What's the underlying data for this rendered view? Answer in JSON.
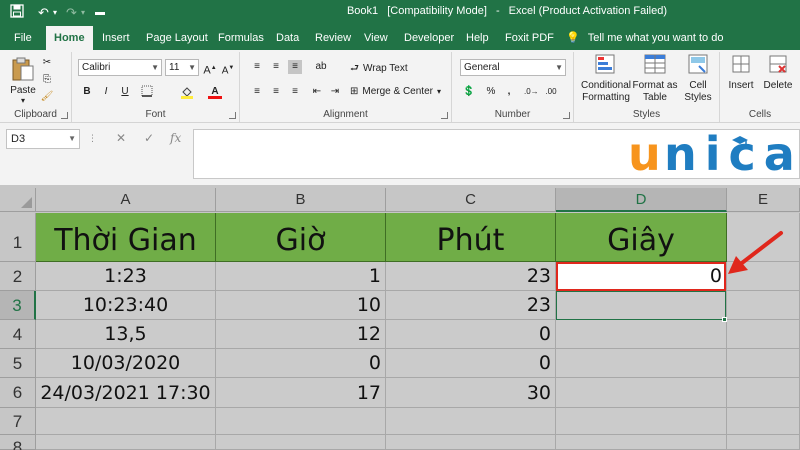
{
  "window": {
    "title_parts": [
      "Book1",
      "[Compatibility Mode]",
      "-",
      "Excel (Product Activation Failed)"
    ]
  },
  "tabs": [
    {
      "label": "File"
    },
    {
      "label": "Home"
    },
    {
      "label": "Insert"
    },
    {
      "label": "Page Layout"
    },
    {
      "label": "Formulas"
    },
    {
      "label": "Data"
    },
    {
      "label": "Review"
    },
    {
      "label": "View"
    },
    {
      "label": "Developer"
    },
    {
      "label": "Help"
    },
    {
      "label": "Foxit PDF"
    }
  ],
  "tell_me": "Tell me what you want to do",
  "ribbon": {
    "clipboard": {
      "paste": "Paste",
      "label": "Clipboard"
    },
    "font": {
      "name": "Calibri",
      "size": "11",
      "label": "Font",
      "bold": "B",
      "italic": "I",
      "underline": "U"
    },
    "alignment": {
      "wrap_text": "Wrap Text",
      "merge_center": "Merge & Center",
      "label": "Alignment"
    },
    "number": {
      "format": "General",
      "label": "Number",
      "percent": "%",
      "comma": ","
    },
    "styles": {
      "conditional_1": "Conditional",
      "conditional_2": "Formatting",
      "format_as_1": "Format as",
      "format_as_2": "Table",
      "cell_1": "Cell",
      "cell_2": "Styles",
      "label": "Styles"
    },
    "cells": {
      "insert": "Insert",
      "delete": "Delete",
      "label": "Cells"
    }
  },
  "formula_bar": {
    "name_box": "D3",
    "fx": "fx",
    "value": ""
  },
  "logo": {
    "text_u": "u",
    "text_rest": "nica"
  },
  "colors": {
    "excel_green": "#217346",
    "header_fill": "#70ad47",
    "highlight": "#e0271c",
    "logo_blue": "#1f7dc1",
    "logo_orange": "#f7941d"
  },
  "columns": [
    "A",
    "B",
    "C",
    "D",
    "E"
  ],
  "rows": [
    "1",
    "2",
    "3",
    "4",
    "5",
    "6",
    "7",
    "8"
  ],
  "sheet": {
    "headers": [
      "Thời Gian",
      "Giờ",
      "Phút",
      "Giây"
    ],
    "data": [
      [
        "1:23",
        "1",
        "23",
        "0"
      ],
      [
        "10:23:40",
        "10",
        "23",
        ""
      ],
      [
        "13,5",
        "12",
        "0",
        ""
      ],
      [
        "10/03/2020",
        "0",
        "0",
        ""
      ],
      [
        "24/03/2021 17:30",
        "17",
        "30",
        ""
      ]
    ]
  },
  "icons": [
    "save-icon",
    "undo-icon",
    "redo-icon",
    "paste-icon",
    "cut-icon",
    "copy-icon",
    "format-painter-icon",
    "bold-icon",
    "italic-icon",
    "underline-icon",
    "fill-color-icon",
    "font-color-icon",
    "wrap-text-icon",
    "merge-icon",
    "lightbulb-icon",
    "arrow-icon"
  ]
}
